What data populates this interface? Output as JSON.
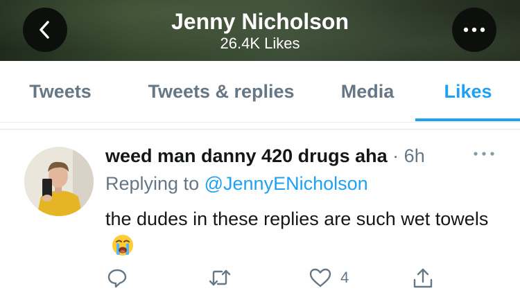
{
  "header": {
    "title": "Jenny Nicholson",
    "subtitle": "26.4K Likes",
    "back_icon": "chevron-left-icon",
    "more_icon": "more-horizontal-icon"
  },
  "tabs": [
    {
      "label": "Tweets",
      "active": false
    },
    {
      "label": "Tweets & replies",
      "active": false
    },
    {
      "label": "Media",
      "active": false
    },
    {
      "label": "Likes",
      "active": true
    }
  ],
  "tweet": {
    "author_name": "weed man danny 420 drugs aha",
    "separator": "·",
    "time": "6h",
    "replying_prefix": "Replying to",
    "replying_handle": "@JennyENicholson",
    "text": "the dudes in these replies are such wet towels",
    "emoji": "loudly-crying-face",
    "actions": {
      "reply_icon": "reply-icon",
      "retweet_icon": "retweet-icon",
      "like_icon": "heart-icon",
      "like_count": "4",
      "share_icon": "share-icon"
    }
  },
  "colors": {
    "accent": "#1da1f2",
    "muted": "#657786",
    "text": "#14171a"
  }
}
